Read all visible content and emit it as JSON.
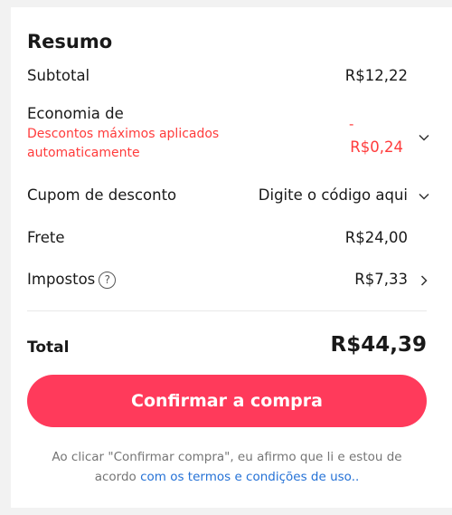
{
  "summary": {
    "title": "Resumo",
    "subtotal": {
      "label": "Subtotal",
      "value": "R$12,22"
    },
    "savings": {
      "label": "Economia de",
      "detail_line1": "Descontos máximos aplicados",
      "detail_line2": "automaticamente",
      "value_sign": "-",
      "value": "R$0,24"
    },
    "coupon": {
      "label": "Cupom de desconto",
      "placeholder": "Digite o código aqui"
    },
    "shipping": {
      "label": "Frete",
      "value": "R$24,00"
    },
    "taxes": {
      "label": "Impostos",
      "help_icon": "?",
      "value": "R$7,33"
    },
    "total": {
      "label": "Total",
      "value": "R$44,39"
    },
    "confirm_label": "Confirmar a compra",
    "legal": {
      "line1": "Ao clicar \"Confirmar compra\", eu afirmo que li e estou de",
      "line2_prefix": "acordo ",
      "link": "com os termos e condições de uso.."
    }
  },
  "colors": {
    "accent": "#ff3a5b",
    "discount_red": "#ff3b3b",
    "link_blue": "#2471d6"
  },
  "icons": {
    "savings_expand": "chevron-down-icon",
    "coupon_expand": "chevron-down-icon",
    "taxes_detail": "chevron-right-icon",
    "taxes_help": "help-circle-icon"
  }
}
